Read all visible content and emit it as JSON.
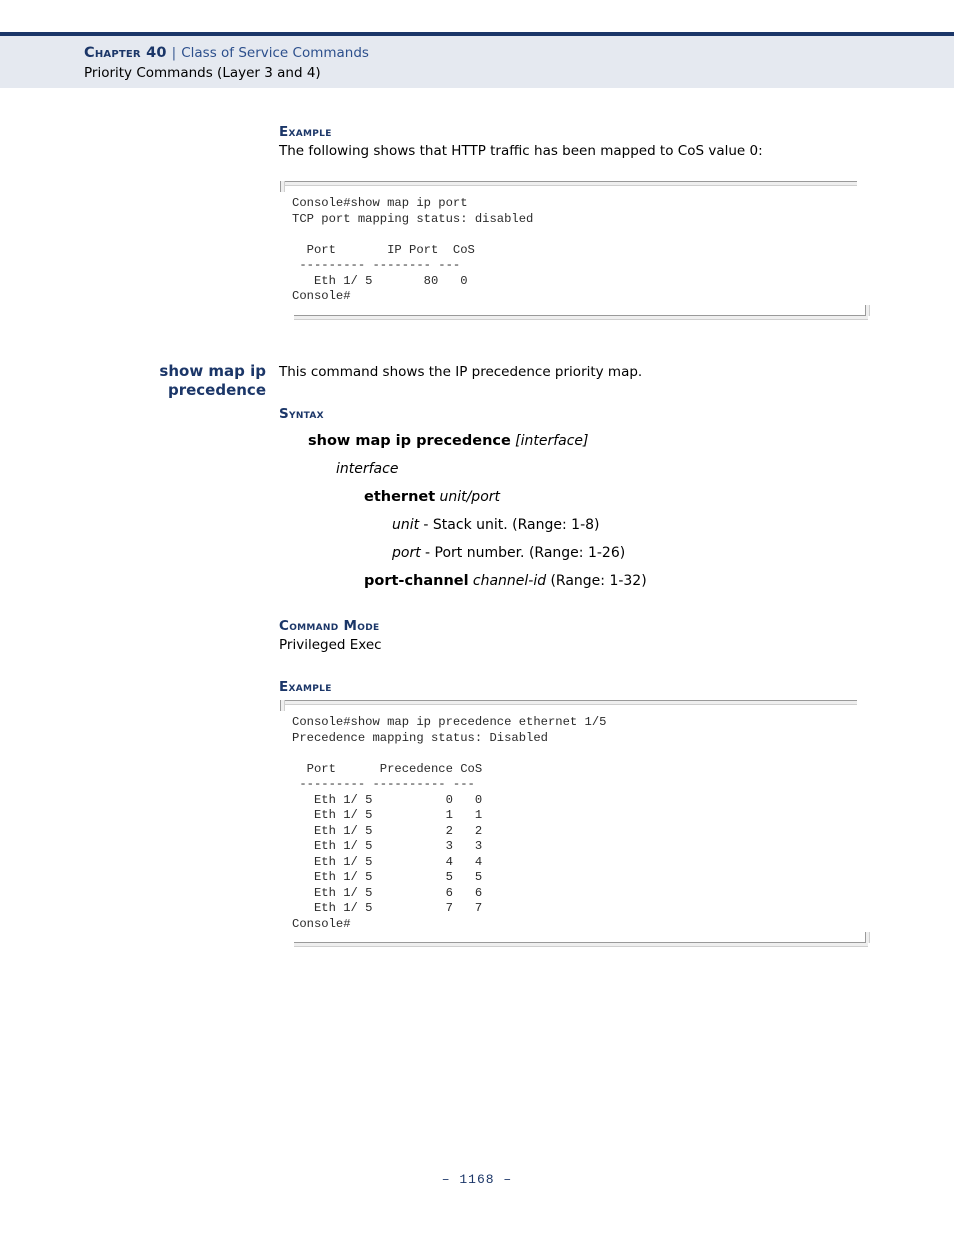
{
  "header": {
    "chapter_label": "Chapter 40",
    "separator": "|",
    "chapter_title": "Class of Service Commands",
    "section_title": "Priority Commands (Layer 3 and 4)"
  },
  "section_labels": {
    "example": "Example",
    "syntax": "Syntax",
    "command_mode": "Command Mode"
  },
  "example_1": {
    "label": "Example",
    "description": "The following shows that HTTP traffic has been mapped to CoS value 0:",
    "code": "Console#show map ip port\nTCP port mapping status: disabled\n\n  Port       IP Port  CoS\n --------- -------- ---\n   Eth 1/ 5       80   0\nConsole#"
  },
  "command": {
    "heading_line1": "show map ip",
    "heading_line2": "precedence",
    "description": "This command shows the IP precedence priority map.",
    "syntax_label": "Syntax",
    "syntax": {
      "command": "show map ip precedence",
      "optional_arg": "[interface]",
      "arg_name": "interface",
      "ethernet_keyword": "ethernet",
      "ethernet_args": "unit/port",
      "unit_param": "unit",
      "unit_desc": "- Stack unit. (Range: 1-8)",
      "port_param": "port",
      "port_desc": "- Port number. (Range: 1-26)",
      "portchannel_keyword": "port-channel",
      "portchannel_arg": "channel-id",
      "portchannel_range": "(Range: 1-32)"
    },
    "command_mode_label": "Command Mode",
    "command_mode_value": "Privileged Exec"
  },
  "example_2": {
    "label": "Example",
    "code": "Console#show map ip precedence ethernet 1/5\nPrecedence mapping status: Disabled\n\n  Port      Precedence CoS\n --------- ---------- ---\n   Eth 1/ 5          0   0\n   Eth 1/ 5          1   1\n   Eth 1/ 5          2   2\n   Eth 1/ 5          3   3\n   Eth 1/ 5          4   4\n   Eth 1/ 5          5   5\n   Eth 1/ 5          6   6\n   Eth 1/ 5          7   7\nConsole#"
  },
  "footer": {
    "page_number": "–  1168  –"
  },
  "colors": {
    "navy": "#1b3668",
    "header_band": "#e5e9f0",
    "link_blue": "#2c4f8c"
  }
}
